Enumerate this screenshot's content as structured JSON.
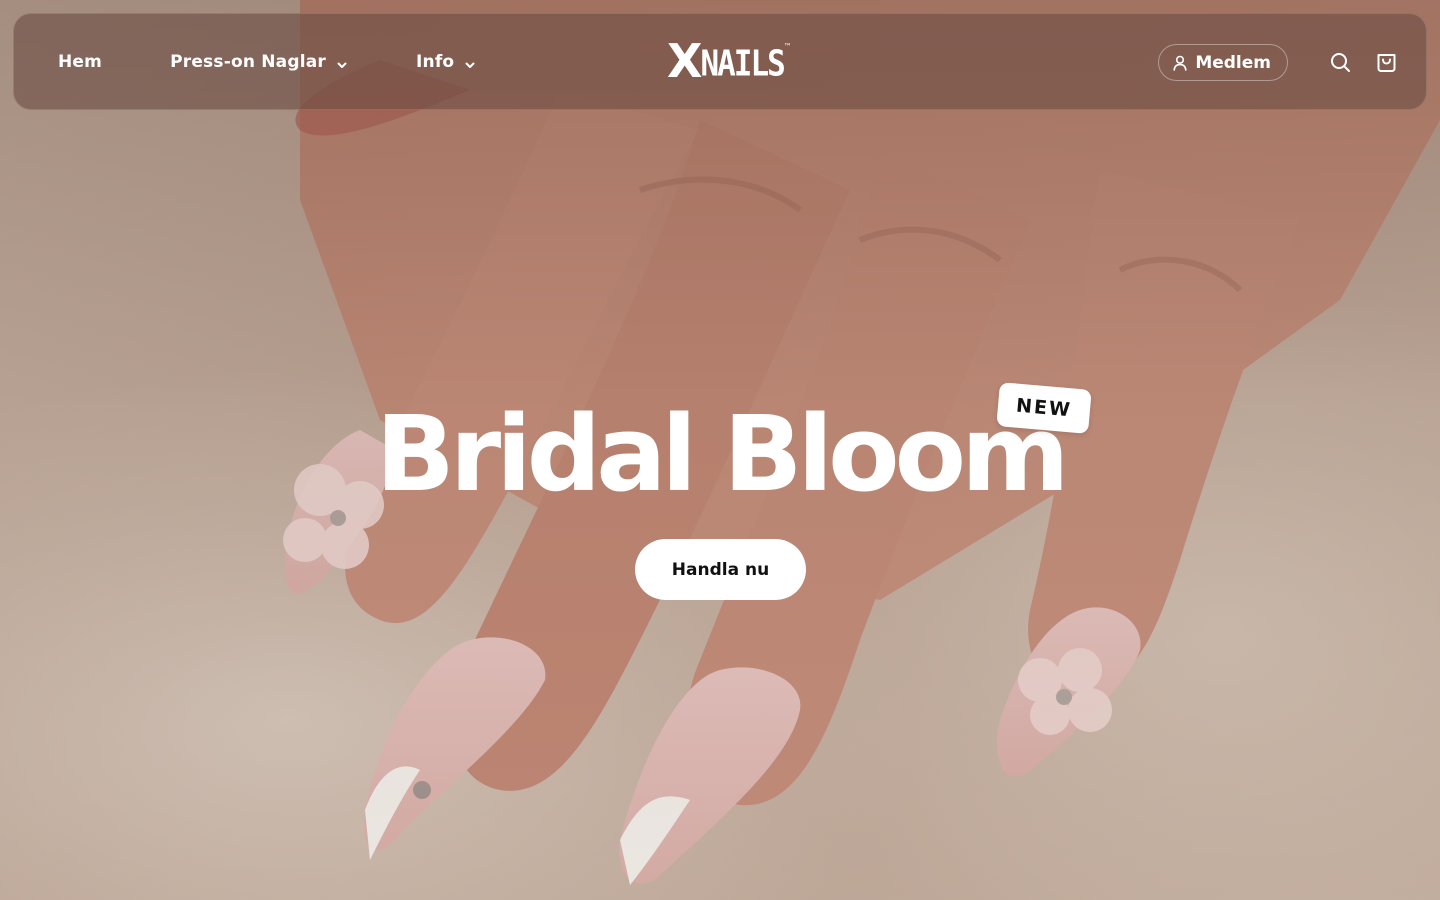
{
  "colors": {
    "header_bg": "#6e4e44",
    "text_on_dark": "#ffffff",
    "button_bg": "#ffffff",
    "button_text": "#111111",
    "skin": "#c98f7e",
    "nail_pink": "#e7c2bd",
    "nail_tip": "#f7f3ee",
    "towel": "#d2c0b2"
  },
  "nav": {
    "items": [
      {
        "label": "Hem",
        "has_dropdown": false
      },
      {
        "label": "Press-on Naglar",
        "has_dropdown": true
      },
      {
        "label": "Info",
        "has_dropdown": true
      }
    ]
  },
  "brand": {
    "logo_x": "X",
    "logo_rest": "NAILS",
    "trademark": "™"
  },
  "header_actions": {
    "member_label": "Medlem",
    "member_icon": "user-icon",
    "search_icon": "search-icon",
    "cart_icon": "shopping-bag-icon"
  },
  "hero": {
    "title": "Bridal Bloom",
    "badge": "NEW",
    "cta_label": "Handla nu",
    "background": "photo of hand with almond-shaped press-on nails, french tips and 3D flower accents"
  }
}
